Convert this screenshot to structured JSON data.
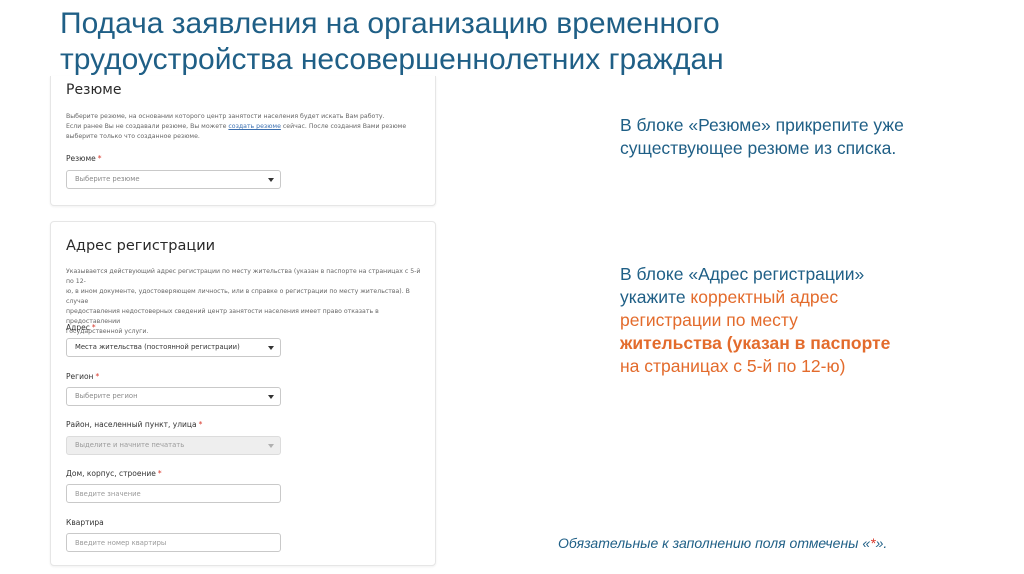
{
  "slide": {
    "title_line1": "Подача заявления на организацию временного",
    "title_line2": "трудоустройства несовершеннолетних граждан"
  },
  "resume_card": {
    "heading": "Резюме",
    "desc_line1": "Выберите резюме, на основании которого центр занятости населения будет искать Вам работу.",
    "desc_line2_pre": "Если ранее Вы не создавали резюме, Вы можете ",
    "desc_link": "создать резюме",
    "desc_line2_post": " сейчас. После создания Вами резюме",
    "desc_line3": "выберите только что созданное резюме.",
    "field_label": "Резюме",
    "required_mark": "*",
    "select_placeholder": "Выберите резюме"
  },
  "address_card": {
    "heading": "Адрес регистрации",
    "desc_line1": "Указывается действующий адрес регистрации по месту жительства (указан в паспорте на страницах с 5-й по 12-",
    "desc_line2": "ю, в ином документе, удостоверяющем личность, или в справке о регистрации по месту жительства). В случае",
    "desc_line3": "предоставления недостоверных сведений центр занятости населения имеет право отказать в предоставлении",
    "desc_line4": "государственной услуги.",
    "address_label": "Адрес",
    "address_value": "Места жительства (постоянной регистрации)",
    "region_label": "Регион",
    "region_placeholder": "Выберите регион",
    "district_label": "Район, населенный пункт, улица",
    "district_placeholder": "Выделите и начните печатать",
    "house_label": "Дом, корпус, строение",
    "house_placeholder": "Введите значение",
    "flat_label": "Квартира",
    "flat_placeholder": "Введите номер квартиры",
    "required_mark": "*"
  },
  "notes": {
    "resume_line1": "В блоке «Резюме» прикрепите уже",
    "resume_line2": "существующее резюме из списка.",
    "addr_line1": "В блоке «Адрес регистрации»",
    "addr_line2_a": "укажите ",
    "addr_line2_b": "корректный адрес",
    "addr_line3": "регистрации по месту",
    "addr_line4": "жительства (указан в паспорте",
    "addr_line5": "на страницах с 5-й по 12-ю)"
  },
  "footnote": {
    "text_pre": "Обязательные к заполнению поля отмечены «",
    "star": "*",
    "text_post": "»."
  },
  "colors": {
    "title_blue": "#1f5f86",
    "accent_orange": "#e36b2c",
    "required_red": "#d9382b"
  }
}
